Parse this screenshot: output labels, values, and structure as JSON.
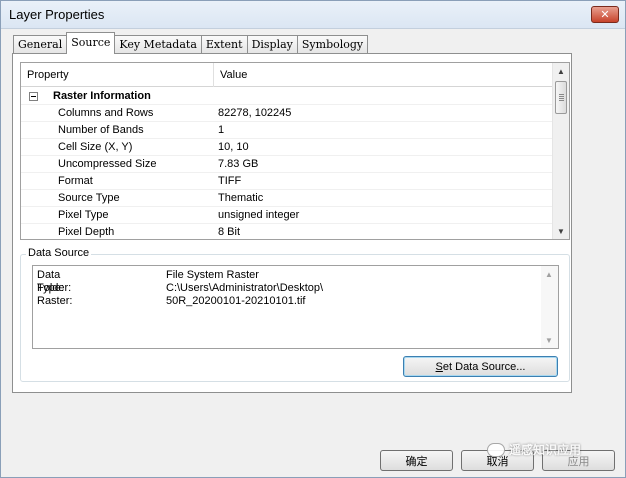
{
  "window": {
    "title": "Layer Properties",
    "close_glyph": "✕"
  },
  "tabs": [
    {
      "label": "General",
      "active": false
    },
    {
      "label": "Source",
      "active": true
    },
    {
      "label": "Key Metadata",
      "active": false
    },
    {
      "label": "Extent",
      "active": false
    },
    {
      "label": "Display",
      "active": false
    },
    {
      "label": "Symbology",
      "active": false
    }
  ],
  "property_grid": {
    "headers": {
      "property": "Property",
      "value": "Value"
    },
    "group": {
      "label": "Raster Information",
      "expander_icon": "collapse-minus-icon"
    },
    "rows": [
      {
        "property": "Columns and Rows",
        "value": "82278, 102245"
      },
      {
        "property": "Number of Bands",
        "value": "1"
      },
      {
        "property": "Cell Size (X, Y)",
        "value": "10, 10"
      },
      {
        "property": "Uncompressed Size",
        "value": "7.83 GB"
      },
      {
        "property": "Format",
        "value": "TIFF"
      },
      {
        "property": "Source Type",
        "value": "Thematic"
      },
      {
        "property": "Pixel Type",
        "value": "unsigned integer"
      },
      {
        "property": "Pixel Depth",
        "value": "8 Bit"
      }
    ],
    "scroll_up": "▲",
    "scroll_down": "▼"
  },
  "data_source": {
    "label": "Data Source",
    "lines": [
      {
        "key": "Data Type:",
        "value": "File System Raster"
      },
      {
        "key": "Folder:",
        "value": "C:\\Users\\Administrator\\Desktop\\"
      },
      {
        "key": "Raster:",
        "value": "50R_20200101-20210101.tif"
      }
    ],
    "set_button": "Set Data Source..."
  },
  "footer": {
    "ok": "确定",
    "cancel": "取消",
    "apply": "应用"
  },
  "watermark": {
    "text": "遥感知识应用"
  },
  "colors": {
    "titlebar": "#dbe6f3",
    "close_button": "#c7432b",
    "default_button_border": "#3c7fb1"
  }
}
